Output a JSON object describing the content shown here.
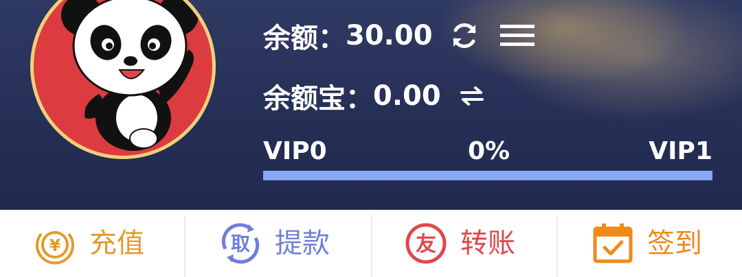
{
  "balance": {
    "label": "余额：",
    "value": "30.00",
    "refresh_icon": "refresh-icon",
    "menu_icon": "menu-icon"
  },
  "yuebao": {
    "label": "余额宝：",
    "value": "0.00",
    "transfer_icon": "transfer-arrows-icon"
  },
  "vip": {
    "current": "VIP0",
    "percent_label": "0%",
    "next": "VIP1",
    "progress": 0
  },
  "actions": [
    {
      "label": "充值",
      "icon": "yen-coin-icon",
      "color": "#e39a2c"
    },
    {
      "label": "提款",
      "icon": "withdraw-icon",
      "color": "#6f7fd8"
    },
    {
      "label": "转账",
      "icon": "transfer-you-icon",
      "color": "#e0474c"
    },
    {
      "label": "签到",
      "icon": "calendar-check-icon",
      "color": "#ee8a1a"
    }
  ],
  "icon_chars": {
    "withdraw": "取",
    "transfer": "友",
    "coin": "¥"
  },
  "colors": {
    "header_bg": "#262f56",
    "avatar_bg": "#dc3b3f",
    "progress": "#8aa6f4"
  }
}
